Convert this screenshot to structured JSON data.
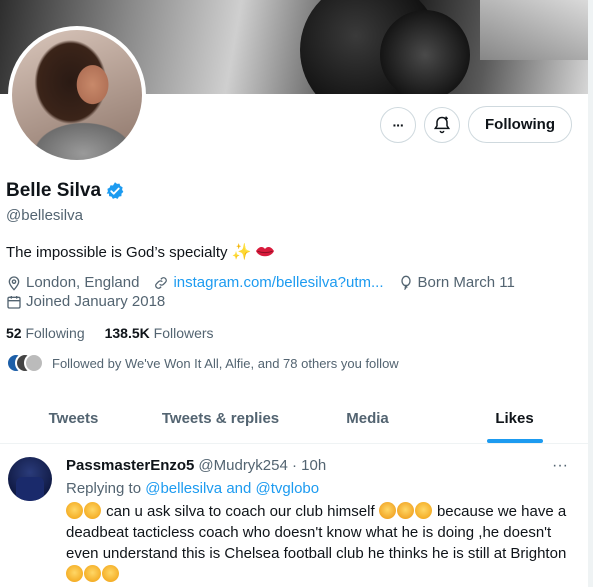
{
  "profile": {
    "name": "Belle Silva",
    "handle": "@bellesilva",
    "bio_text": "The impossible is God’s specialty",
    "location": "London, England",
    "link": "instagram.com/bellesilva?utm...",
    "born": "Born March 11",
    "joined": "Joined January 2018",
    "following_count": "52",
    "following_label": "Following",
    "followers_count": "138.5K",
    "followers_label": "Followers",
    "followed_by": "Followed by We've Won It All, Alfie, and 78 others you follow"
  },
  "actions": {
    "more_label": "···",
    "follow_label": "Following"
  },
  "tabs": [
    {
      "label": "Tweets"
    },
    {
      "label": "Tweets & replies"
    },
    {
      "label": "Media"
    },
    {
      "label": "Likes"
    }
  ],
  "tweet": {
    "author": "PassmasterEnzo5",
    "handle_time": "@Mudryk254 · 10h",
    "reply_prefix": "Replying to",
    "reply_targets": "@bellesilva and @tvglobo",
    "more_label": "···",
    "text_part1": " can u ask silva to coach our club himself ",
    "text_part2": " because we have a deadbeat  tacticless coach who doesn't know what he is doing ,he doesn't even understand this is Chelsea football club he thinks he is still at Brighton "
  },
  "colors": {
    "accent": "#1d9bf0",
    "text_primary": "#0f1419",
    "text_secondary": "#536471"
  }
}
